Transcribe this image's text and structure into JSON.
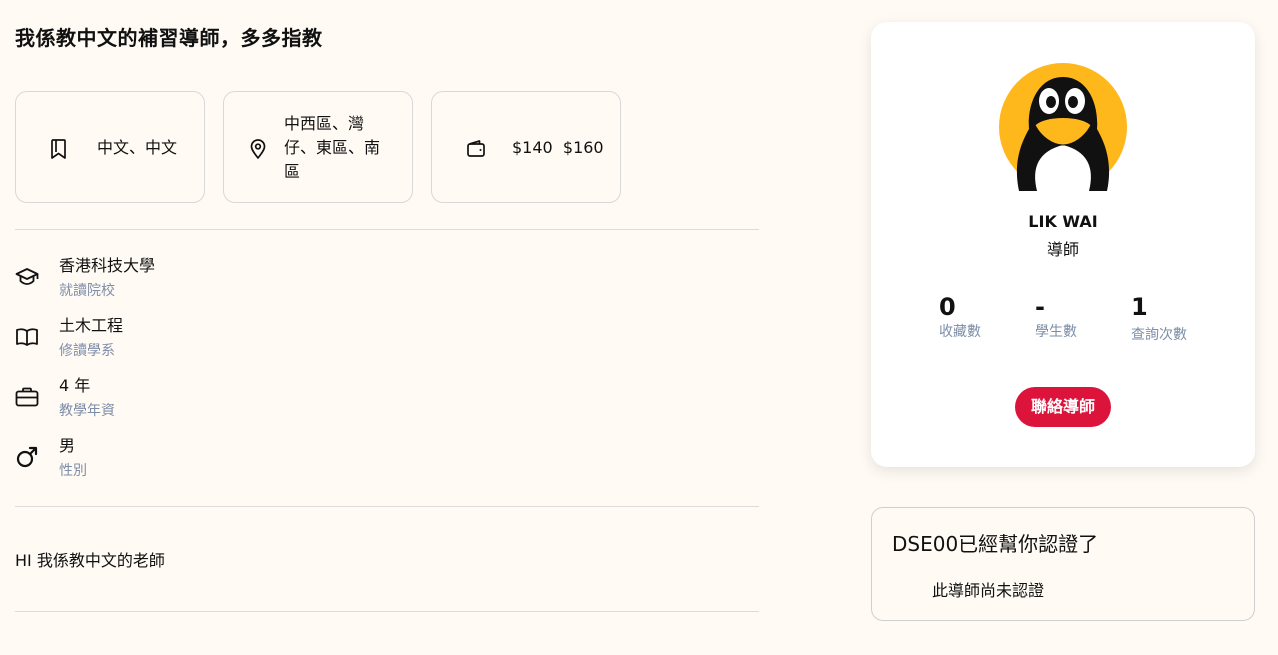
{
  "headline": "我係教中文的補習導師，多多指教",
  "cards": {
    "subjects": "中文、中文",
    "districts": "中西區、灣仔、東區、南區",
    "fees": "$140  $160"
  },
  "info": [
    {
      "value": "香港科技大學",
      "label": "就讀院校",
      "icon": "graduation-cap-icon"
    },
    {
      "value": "土木工程",
      "label": "修讀學系",
      "icon": "book-icon"
    },
    {
      "value": "4 年",
      "label": "教學年資",
      "icon": "briefcase-icon"
    },
    {
      "value": "男",
      "label": "性別",
      "icon": "male-icon"
    }
  ],
  "bio": "HI 我係教中文的老師",
  "profile": {
    "name": "LIK WAI",
    "role": "導師",
    "stats": [
      {
        "value": "0",
        "label": "收藏數"
      },
      {
        "value": "-",
        "label": "學生數"
      },
      {
        "value": "1",
        "label": "查詢次數"
      }
    ],
    "contact_label": "聯絡導師"
  },
  "verification": {
    "title": "DSE00已經幫你認證了",
    "status": "此導師尚未認證"
  },
  "colors": {
    "background": "#fffaf4",
    "accent": "#dc143c",
    "muted_label": "#7d8ea8",
    "avatar_yellow": "#ffb81c"
  }
}
